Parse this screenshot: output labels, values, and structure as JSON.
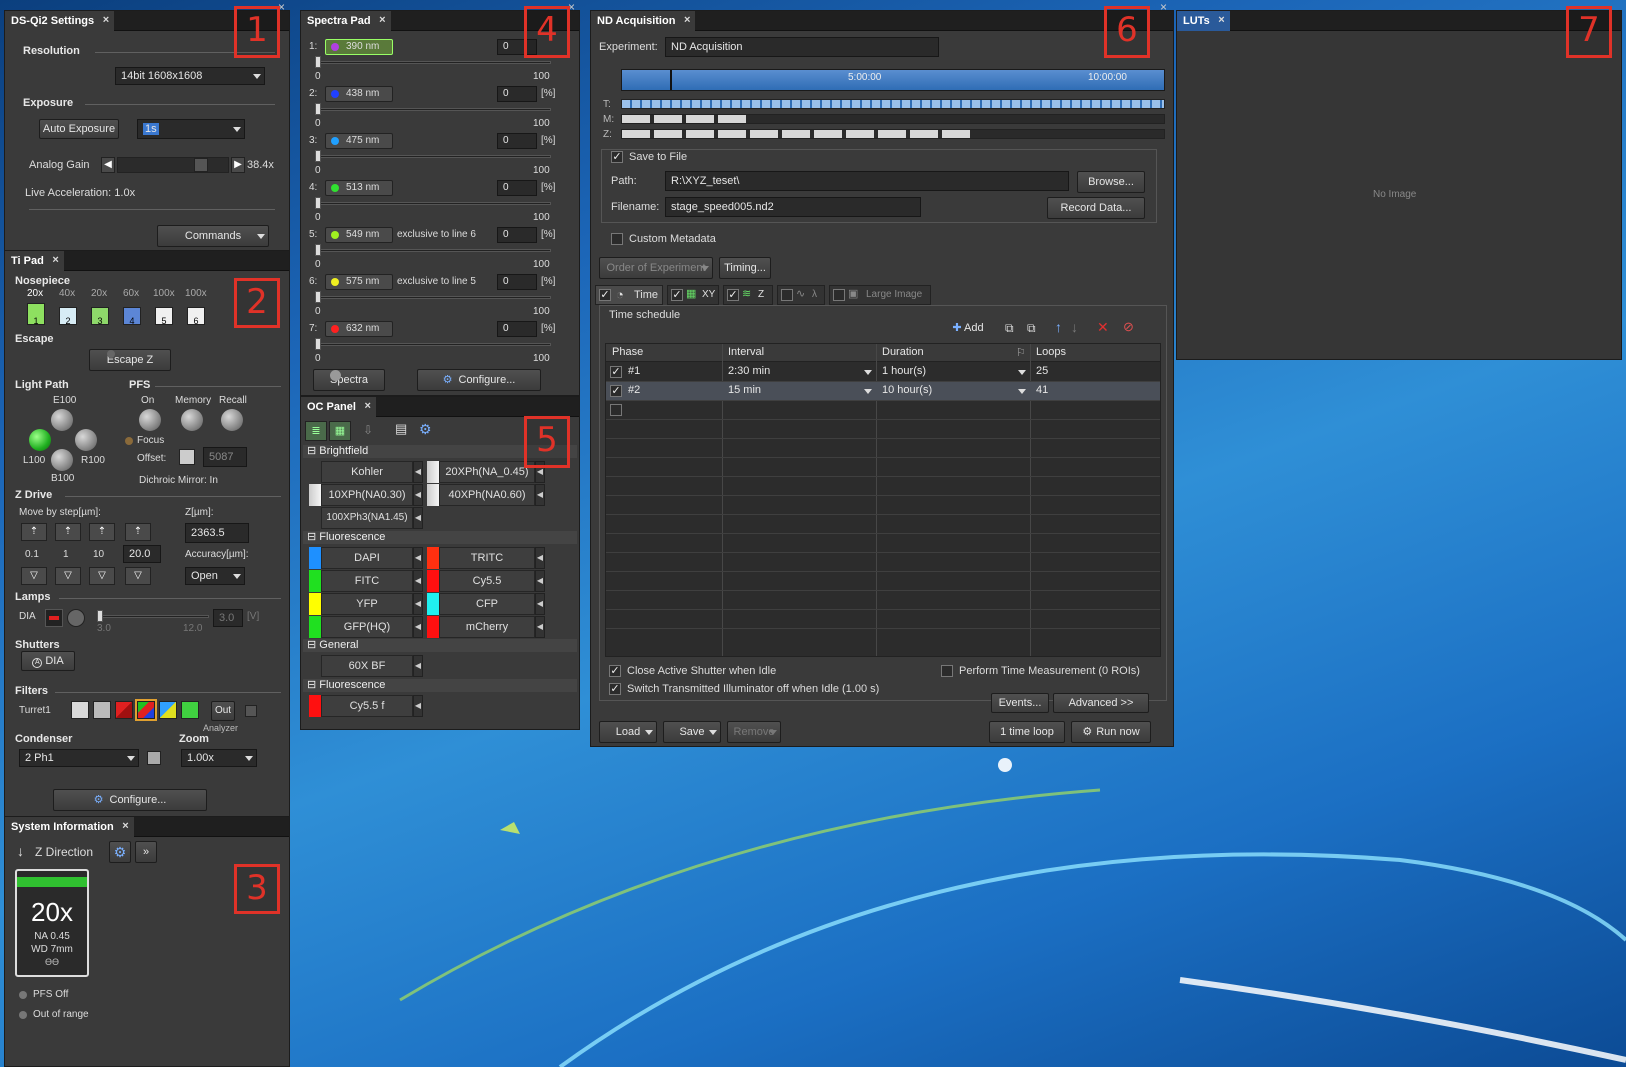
{
  "ds_qi2": {
    "title": "DS-Qi2 Settings",
    "resolution_label": "Resolution",
    "resolution_value": "14bit 1608x1608",
    "exposure_label": "Exposure",
    "auto_exposure": "Auto Exposure",
    "exposure_value": "1s",
    "analog_gain_label": "Analog Gain",
    "analog_gain_value": "38.4x",
    "live_accel": "Live Acceleration: 1.0x",
    "commands": "Commands"
  },
  "tipad": {
    "title": "Ti Pad",
    "nosepiece_label": "Nosepiece",
    "objectives": [
      "20x",
      "40x",
      "20x",
      "60x",
      "100x",
      "100x"
    ],
    "slots": [
      "1",
      "2",
      "3",
      "4",
      "5",
      "6"
    ],
    "escape_label": "Escape",
    "escape_z": "Escape Z",
    "lightpath_label": "Light Path",
    "lp_e100": "E100",
    "lp_l100": "L100",
    "lp_r100": "R100",
    "lp_b100": "B100",
    "pfs_label": "PFS",
    "pfs_on": "On",
    "pfs_memory": "Memory",
    "pfs_recall": "Recall",
    "focus": "Focus",
    "offset_label": "Offset:",
    "offset_value": "5087",
    "dichroic": "Dichroic Mirror: In",
    "zdrive_label": "Z Drive",
    "move_by_step": "Move by step[µm]:",
    "z_um": "Z[µm]:",
    "z_value": "2363.5",
    "steps": [
      "0.1",
      "1",
      "10"
    ],
    "step_custom": "20.0",
    "accuracy_label": "Accuracy[µm]:",
    "accuracy_value": "Open",
    "lamps_label": "Lamps",
    "dia": "DIA",
    "lamp_min": "3.0",
    "lamp_max": "12.0",
    "lamp_value": "3.0",
    "lamp_unit": "[V]",
    "shutters_label": "Shutters",
    "shutter_dia": "DIA",
    "filters_label": "Filters",
    "turret": "Turret1",
    "out": "Out",
    "analyzer": "Analyzer",
    "condenser_label": "Condenser",
    "condenser_value": "2 Ph1",
    "zoom_label": "Zoom",
    "zoom_value": "1.00x",
    "configure": "Configure..."
  },
  "sysinfo": {
    "title": "System Information",
    "z_direction": "Z Direction",
    "obj_mag": "20x",
    "obj_na": "NA 0.45",
    "obj_wd": "WD 7mm",
    "obj_code": "ӨӨ",
    "pfs_off": "PFS Off",
    "out_of_range": "Out of range"
  },
  "spectra": {
    "title": "Spectra Pad",
    "lines": [
      {
        "num": "1:",
        "wl": "390 nm",
        "note": "",
        "value": "0",
        "color": "#b040e0"
      },
      {
        "num": "2:",
        "wl": "438 nm",
        "note": "",
        "value": "0",
        "color": "#2040ff"
      },
      {
        "num": "3:",
        "wl": "475 nm",
        "note": "",
        "value": "0",
        "color": "#20a0ff"
      },
      {
        "num": "4:",
        "wl": "513 nm",
        "note": "",
        "value": "0",
        "color": "#30e030"
      },
      {
        "num": "5:",
        "wl": "549 nm",
        "note": "exclusive to line 6",
        "value": "0",
        "color": "#a0f020"
      },
      {
        "num": "6:",
        "wl": "575 nm",
        "note": "exclusive to line 5",
        "value": "0",
        "color": "#f0f020"
      },
      {
        "num": "7:",
        "wl": "632 nm",
        "note": "",
        "value": "0",
        "color": "#ff2020"
      }
    ],
    "unit": "[%]",
    "scale_min": "0",
    "scale_max": "100",
    "spectra_btn": "Spectra",
    "configure": "Configure..."
  },
  "oc": {
    "title": "OC Panel",
    "group1": "Brightfield",
    "bf": [
      "Kohler",
      "20XPh(NA_0.45)",
      "10XPh(NA0.30)",
      "40XPh(NA0.60)",
      "100XPh3(NA1.45)"
    ],
    "group2": "Fluorescence",
    "fl": [
      {
        "name": "DAPI",
        "color": "#1e90ff"
      },
      {
        "name": "TRITC",
        "color": "#ff3010"
      },
      {
        "name": "FITC",
        "color": "#20e020"
      },
      {
        "name": "Cy5.5",
        "color": "#ff1010"
      },
      {
        "name": "YFP",
        "color": "#ffff00"
      },
      {
        "name": "CFP",
        "color": "#20f0f0"
      },
      {
        "name": "GFP(HQ)",
        "color": "#20e020"
      },
      {
        "name": "mCherry",
        "color": "#ff1010"
      }
    ],
    "group3": "General",
    "gen": [
      "60X BF"
    ],
    "group4": "Fluorescence",
    "fl2": [
      {
        "name": "Cy5.5 f",
        "color": "#ff1010"
      }
    ]
  },
  "nd": {
    "title": "ND Acquisition",
    "experiment_label": "Experiment:",
    "experiment_value": "ND Acquisition",
    "tick1": "5:00:00",
    "tick2": "10:00:00",
    "row_t": "T:",
    "row_m": "M:",
    "row_z": "Z:",
    "save_to_file": "Save to File",
    "path_label": "Path:",
    "path_value": "R:\\XYZ_teset\\",
    "browse": "Browse...",
    "filename_label": "Filename:",
    "filename_value": "stage_speed005.nd2",
    "record": "Record Data...",
    "custom_metadata": "Custom Metadata",
    "order": "Order of Experiment",
    "timing": "Timing...",
    "tabs": [
      "Time",
      "XY",
      "Z",
      "λ",
      "Large Image"
    ],
    "schedule": "Time schedule",
    "add": "Add",
    "headers": [
      "Phase",
      "Interval",
      "Duration",
      "Loops"
    ],
    "rows": [
      {
        "phase": "#1",
        "interval": "2:30 min",
        "duration": "1 hour(s)",
        "loops": "25"
      },
      {
        "phase": "#2",
        "interval": "15 min",
        "duration": "10 hour(s)",
        "loops": "41"
      }
    ],
    "close_shutter": "Close Active Shutter when Idle",
    "perform_time": "Perform Time Measurement (0 ROIs)",
    "switch_illum": "Switch Transmitted Illuminator off when Idle (1.00 s)",
    "events": "Events...",
    "advanced": "Advanced >>",
    "load": "Load",
    "save": "Save",
    "remove": "Remove",
    "time_loop": "1 time loop",
    "run_now": "Run now"
  },
  "luts": {
    "title": "LUTs",
    "no_image": "No Image"
  },
  "markers": [
    "1",
    "2",
    "3",
    "4",
    "5",
    "6",
    "7"
  ]
}
